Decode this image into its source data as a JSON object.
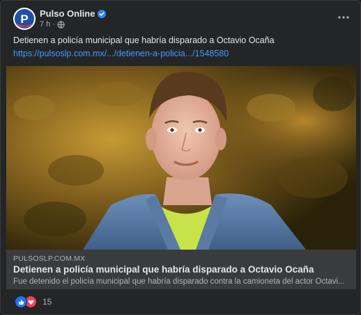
{
  "post": {
    "author": "Pulso Online",
    "time": "7 h ·",
    "text": "Detienen a policía municipal que habría disparado a Octavio Ocaña",
    "link": "https://pulsoslp.com.mx/.../detienen-a-policia.../1548580",
    "avatar_letter": "P"
  },
  "preview": {
    "domain": "PULSOSLP.COM.MX",
    "title": "Detienen a policía municipal que habría disparado a Octavio Ocaña",
    "description": "Fue detenido el policía municipal que habría disparado contra la camioneta del actor Octavi..."
  },
  "reactions": {
    "count": "15",
    "icons": [
      "like-icon",
      "love-icon"
    ]
  },
  "colors": {
    "background": "#242526",
    "link": "#4599ff",
    "like": "#1877f2",
    "love": "#f33e58",
    "verified": "#2d88ff"
  }
}
